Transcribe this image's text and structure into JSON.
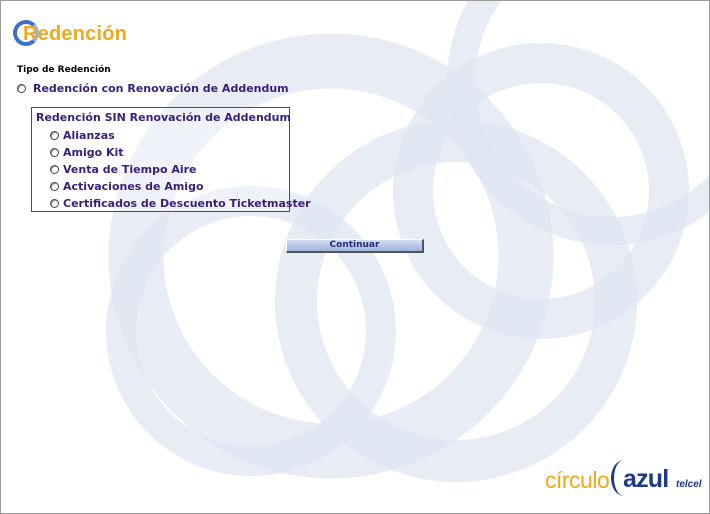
{
  "header": {
    "title": "Redención"
  },
  "form": {
    "section_label": "Tipo de Redención",
    "option_con": "Redención con Renovación de Addendum",
    "group_sin": {
      "title": "Redención SIN Renovación de Addendum",
      "items": [
        "Alianzas",
        "Amigo Kit",
        "Venta de Tiempo Aire",
        "Activaciones de Amigo",
        "Certificados de Descuento Ticketmaster"
      ]
    },
    "submit_label": "Continuar"
  },
  "brand": {
    "circulo": "círculo",
    "azul": "azul",
    "telcel": "telcel"
  },
  "colors": {
    "title_orange": "#f0a820",
    "label_purple": "#3a1f7a",
    "box_border": "#3b40c8",
    "brand_blue": "#1d3a8a",
    "ring_fill": "#dde4f1"
  }
}
